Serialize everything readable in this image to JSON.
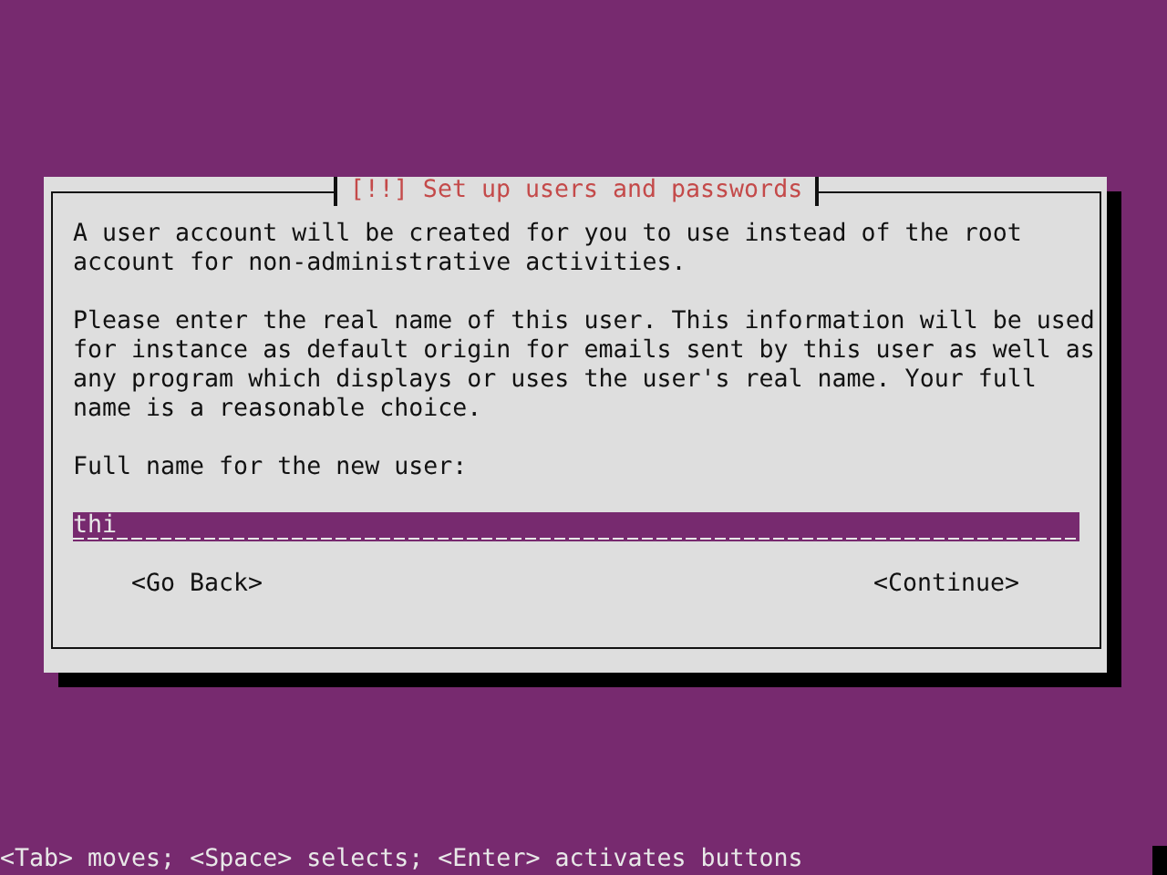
{
  "dialog": {
    "title": "[!!] Set up users and passwords",
    "paragraphs": [
      "A user account will be created for you to use instead of the root account for non-administrative activities.",
      "Please enter the real name of this user. This information will be used for instance as default origin for emails sent by this user as well as any program which displays or uses the user's real name. Your full name is a reasonable choice."
    ],
    "field_label": "Full name for the new user:",
    "field_value": "thi",
    "buttons": [
      "<Go Back>",
      "<Continue>"
    ]
  },
  "help_bar": "<Tab> moves; <Space> selects; <Enter> activates buttons"
}
